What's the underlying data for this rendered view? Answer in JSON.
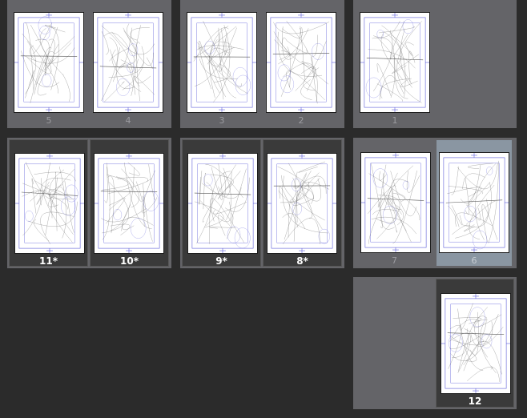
{
  "pages": {
    "p5": {
      "label": "5"
    },
    "p4": {
      "label": "4"
    },
    "p3": {
      "label": "3"
    },
    "p2": {
      "label": "2"
    },
    "p1": {
      "label": "1"
    },
    "p11": {
      "label": "11*"
    },
    "p10": {
      "label": "10*"
    },
    "p9": {
      "label": "9*"
    },
    "p8": {
      "label": "8*"
    },
    "p7": {
      "label": "7"
    },
    "p6": {
      "label": "6"
    },
    "p12": {
      "label": "12"
    }
  },
  "colors": {
    "background": "#2b2b2b",
    "spread": "#646468",
    "selected": "#8a96a2",
    "guide": "#5a5ad8",
    "sketch": "#555555"
  }
}
